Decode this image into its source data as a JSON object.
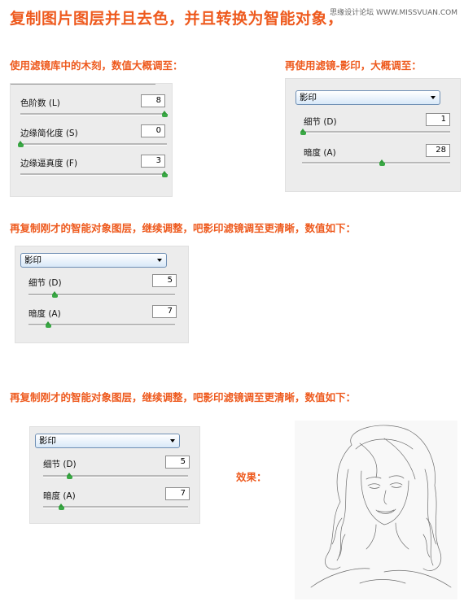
{
  "watermark": "思缘设计论坛 WWW.MISSVUAN.COM",
  "title": "复制图片图层并且去色，并且转换为智能对象，",
  "section1": {
    "heading": "使用滤镜库中的木刻，数值大概调至：",
    "rows": [
      {
        "label": "色阶数 (L)",
        "value": "8",
        "level": 1.0
      },
      {
        "label": "边缘简化度 (S)",
        "value": "0",
        "level": 0.0
      },
      {
        "label": "边缘逼真度 (F)",
        "value": "3",
        "level": 1.0
      }
    ]
  },
  "section2": {
    "heading": "再使用滤镜-影印，大概调至：",
    "select": "影印",
    "rows": [
      {
        "label": "细节 (D)",
        "value": "1",
        "level": 0.0
      },
      {
        "label": "暗度 (A)",
        "value": "28",
        "level": 0.56
      }
    ]
  },
  "section3": {
    "heading": "再复制刚才的智能对象图层，继续调整，吧影印滤镜调至更清晰，数值如下：",
    "select": "影印",
    "rows": [
      {
        "label": "细节 (D)",
        "value": "5",
        "level": 0.17
      },
      {
        "label": "暗度 (A)",
        "value": "7",
        "level": 0.14
      }
    ]
  },
  "section4": {
    "heading": "再复制刚才的智能对象图层，继续调整，吧影印滤镜调至更清晰，数值如下：",
    "select": "影印",
    "rows": [
      {
        "label": "细节 (D)",
        "value": "5",
        "level": 0.17
      },
      {
        "label": "暗度 (A)",
        "value": "7",
        "level": 0.14
      }
    ]
  },
  "result_label": "效果："
}
